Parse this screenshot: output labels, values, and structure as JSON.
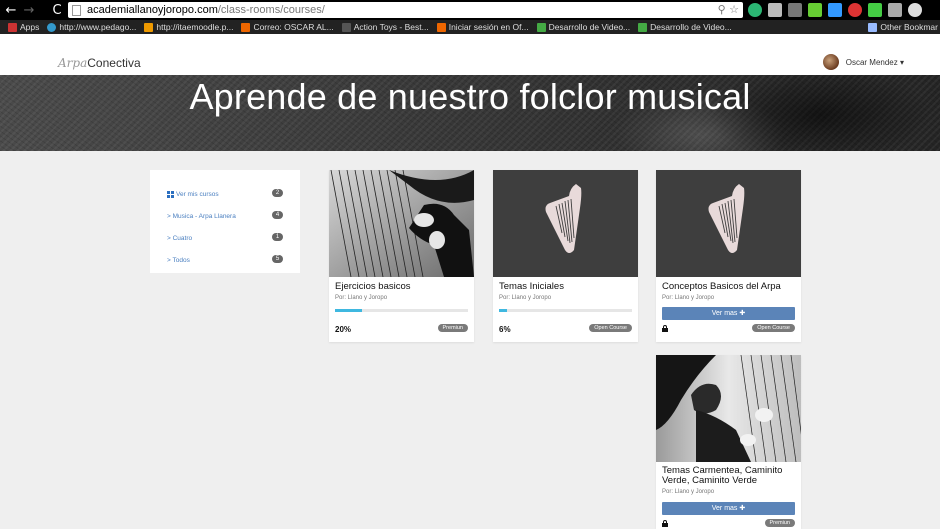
{
  "browser": {
    "url_host": "academiallanoyjoropo.com",
    "url_path": "/class-rooms/courses/",
    "bookmarks": [
      {
        "label": "Apps",
        "color": "#c33"
      },
      {
        "label": "http://www.pedago...",
        "color": "#39c"
      },
      {
        "label": "http://itaemoodle.p...",
        "color": "#e90"
      },
      {
        "label": "Correo: OSCAR AL...",
        "color": "#e60"
      },
      {
        "label": "Action Toys - Best...",
        "color": "#555"
      },
      {
        "label": "Iniciar sesión en Of...",
        "color": "#e60"
      },
      {
        "label": "Desarrollo de Video...",
        "color": "#4a4"
      },
      {
        "label": "Desarrollo de Video...",
        "color": "#4a4"
      }
    ],
    "other_bookmarks": "Other Bookmar"
  },
  "header": {
    "logo_script": "Arpa",
    "logo_text": "Conectiva",
    "user_name": "Oscar Mendez ▾"
  },
  "hero": {
    "title": "Aprende de nuestro folclor musical"
  },
  "sidebar": {
    "items": [
      {
        "label": "Ver mis cursos",
        "count": "2"
      },
      {
        "label": "> Musica - Arpa Llanera",
        "count": "4"
      },
      {
        "label": "> Cuatro",
        "count": "1"
      },
      {
        "label": "> Todos",
        "count": "5"
      }
    ]
  },
  "courses": [
    {
      "title": "Ejercicios basicos",
      "author": "Por: Llano y Joropo",
      "progress": 0.2,
      "progress_label": "20%",
      "tag": "Premiun"
    },
    {
      "title": "Temas Iniciales",
      "author": "Por: Llano y Joropo",
      "progress": 0.06,
      "progress_label": "6%",
      "tag": "Open Course"
    },
    {
      "title": "Conceptos Basicos del Arpa",
      "author": "Por: Llano y Joropo",
      "button": "Ver mas ✚",
      "tag": "Open Course"
    },
    {
      "title": "Temas Carmentea, Caminito Verde, Caminito Verde",
      "author": "Por: Llano y Joropo",
      "button": "Ver mas ✚",
      "tag": "Premiun"
    }
  ],
  "colors": {
    "accent": "#5b84b8",
    "progress": "#3fb8e0",
    "link": "#4a7fc0"
  }
}
